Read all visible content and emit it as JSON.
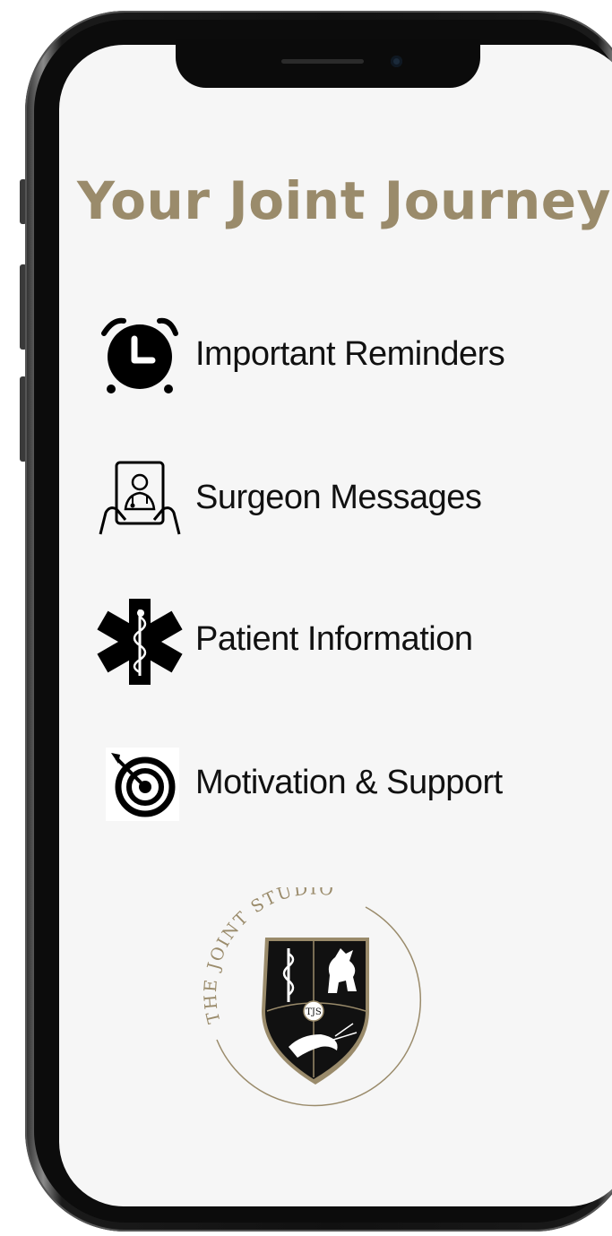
{
  "header": {
    "title": "Your Joint Journey"
  },
  "menu": {
    "items": [
      {
        "label": "Important Reminders",
        "icon": "alarm-clock-icon"
      },
      {
        "label": "Surgeon Messages",
        "icon": "tablet-doctor-icon"
      },
      {
        "label": "Patient Information",
        "icon": "star-of-life-icon"
      },
      {
        "label": "Motivation & Support",
        "icon": "target-icon"
      }
    ]
  },
  "logo": {
    "text": "THE JOINT STUDIO",
    "monogram": "TJS"
  },
  "colors": {
    "accent": "#9a8b6b",
    "text": "#111111",
    "background": "#f6f6f6"
  }
}
